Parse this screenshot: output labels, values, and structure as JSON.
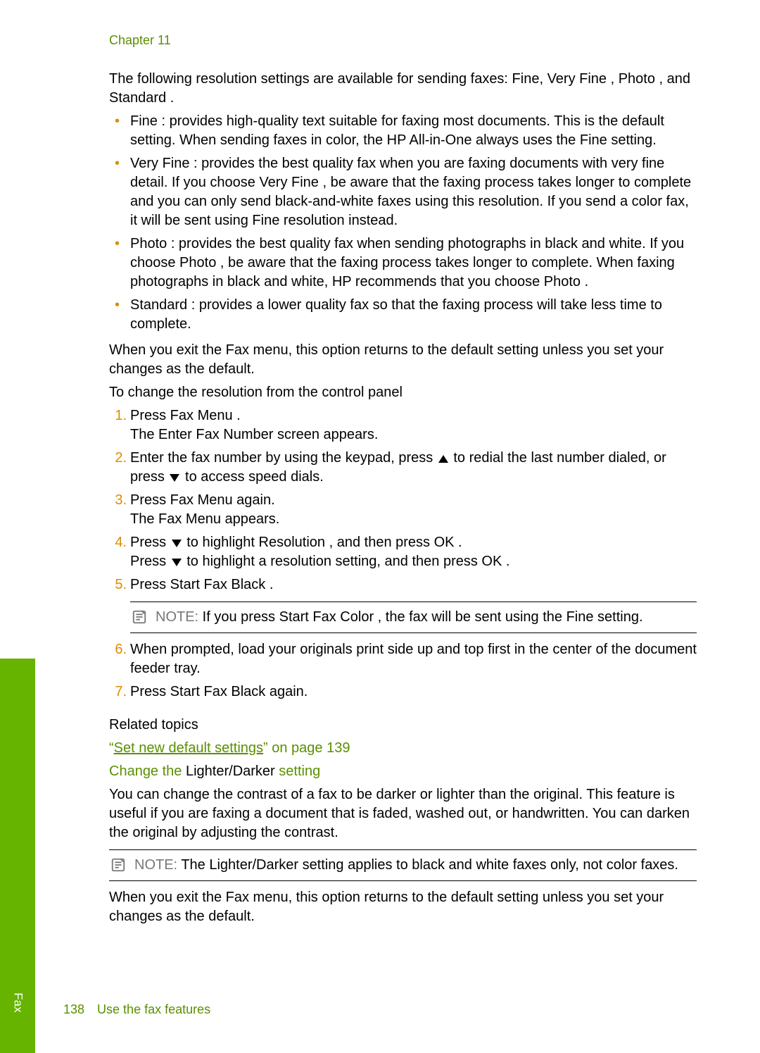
{
  "chapter": "Chapter 11",
  "intro1": "The following resolution settings are available for sending faxes: Fine, Very Fine , Photo , and Standard .",
  "bullets": [
    "Fine : provides high-quality text suitable for faxing most documents. This is the default setting. When sending faxes in color, the HP All-in-One always uses the Fine setting.",
    "Very Fine : provides the best quality fax when you are faxing documents with very fine detail. If you choose Very Fine , be aware that the faxing process takes longer to complete and you can only send black-and-white faxes using this resolution. If you send a color fax, it will be sent using Fine resolution instead.",
    "Photo : provides the best quality fax when sending photographs in black and white. If you choose Photo , be aware that the faxing process takes longer to complete. When faxing photographs in black and white, HP recommends that you choose Photo .",
    "Standard : provides a lower quality fax so that the faxing process will take less time to complete."
  ],
  "afterBullets": "When you exit the Fax menu, this option returns to the default setting unless you set your changes as the default.",
  "procTitle": "To change the resolution from the control panel",
  "steps": {
    "s1a": "Press Fax Menu .",
    "s1b": "The Enter Fax Number  screen appears.",
    "s2a": "Enter the fax number by using the keypad, press ",
    "s2b": " to redial the last number dialed, or press ",
    "s2c": " to access speed dials.",
    "s3a": "Press Fax Menu  again.",
    "s3b": "The Fax Menu  appears.",
    "s4a": "Press ",
    "s4b": " to highlight Resolution  , and then press OK .",
    "s4c": "Press ",
    "s4d": " to highlight a resolution setting, and then press OK .",
    "s5": "Press Start Fax Black  .",
    "noteLabel": "NOTE:",
    "noteText": "  If you press Start Fax Color  , the fax will be sent using the Fine  setting.",
    "s6": "When prompted, load your originals print side up and top first in the center of the document feeder tray.",
    "s7": "Press Start Fax Black  again."
  },
  "relatedTitle": "Related topics",
  "relatedLinkQuoteOpen": "“",
  "relatedLink": "Set new default settings",
  "relatedLinkTail": "” on page 139",
  "sub2a": "Change the ",
  "sub2b": " Lighter/Darker ",
  "sub2c": "  setting",
  "ldPara": "You can change the contrast of a fax to be darker or lighter than the original. This feature is useful if you are faxing a document that is faded, washed out, or handwritten. You can darken the original by adjusting the contrast.",
  "note2Label": "NOTE:",
  "note2Text": "  The Lighter/Darker  setting applies to black and white faxes only, not color faxes.",
  "afterNote2": "When you exit the Fax menu, this option returns to the default setting unless you set your changes as the default.",
  "footerPage": "138",
  "footerTitle": "Use the fax features",
  "sideTab": "Fax"
}
